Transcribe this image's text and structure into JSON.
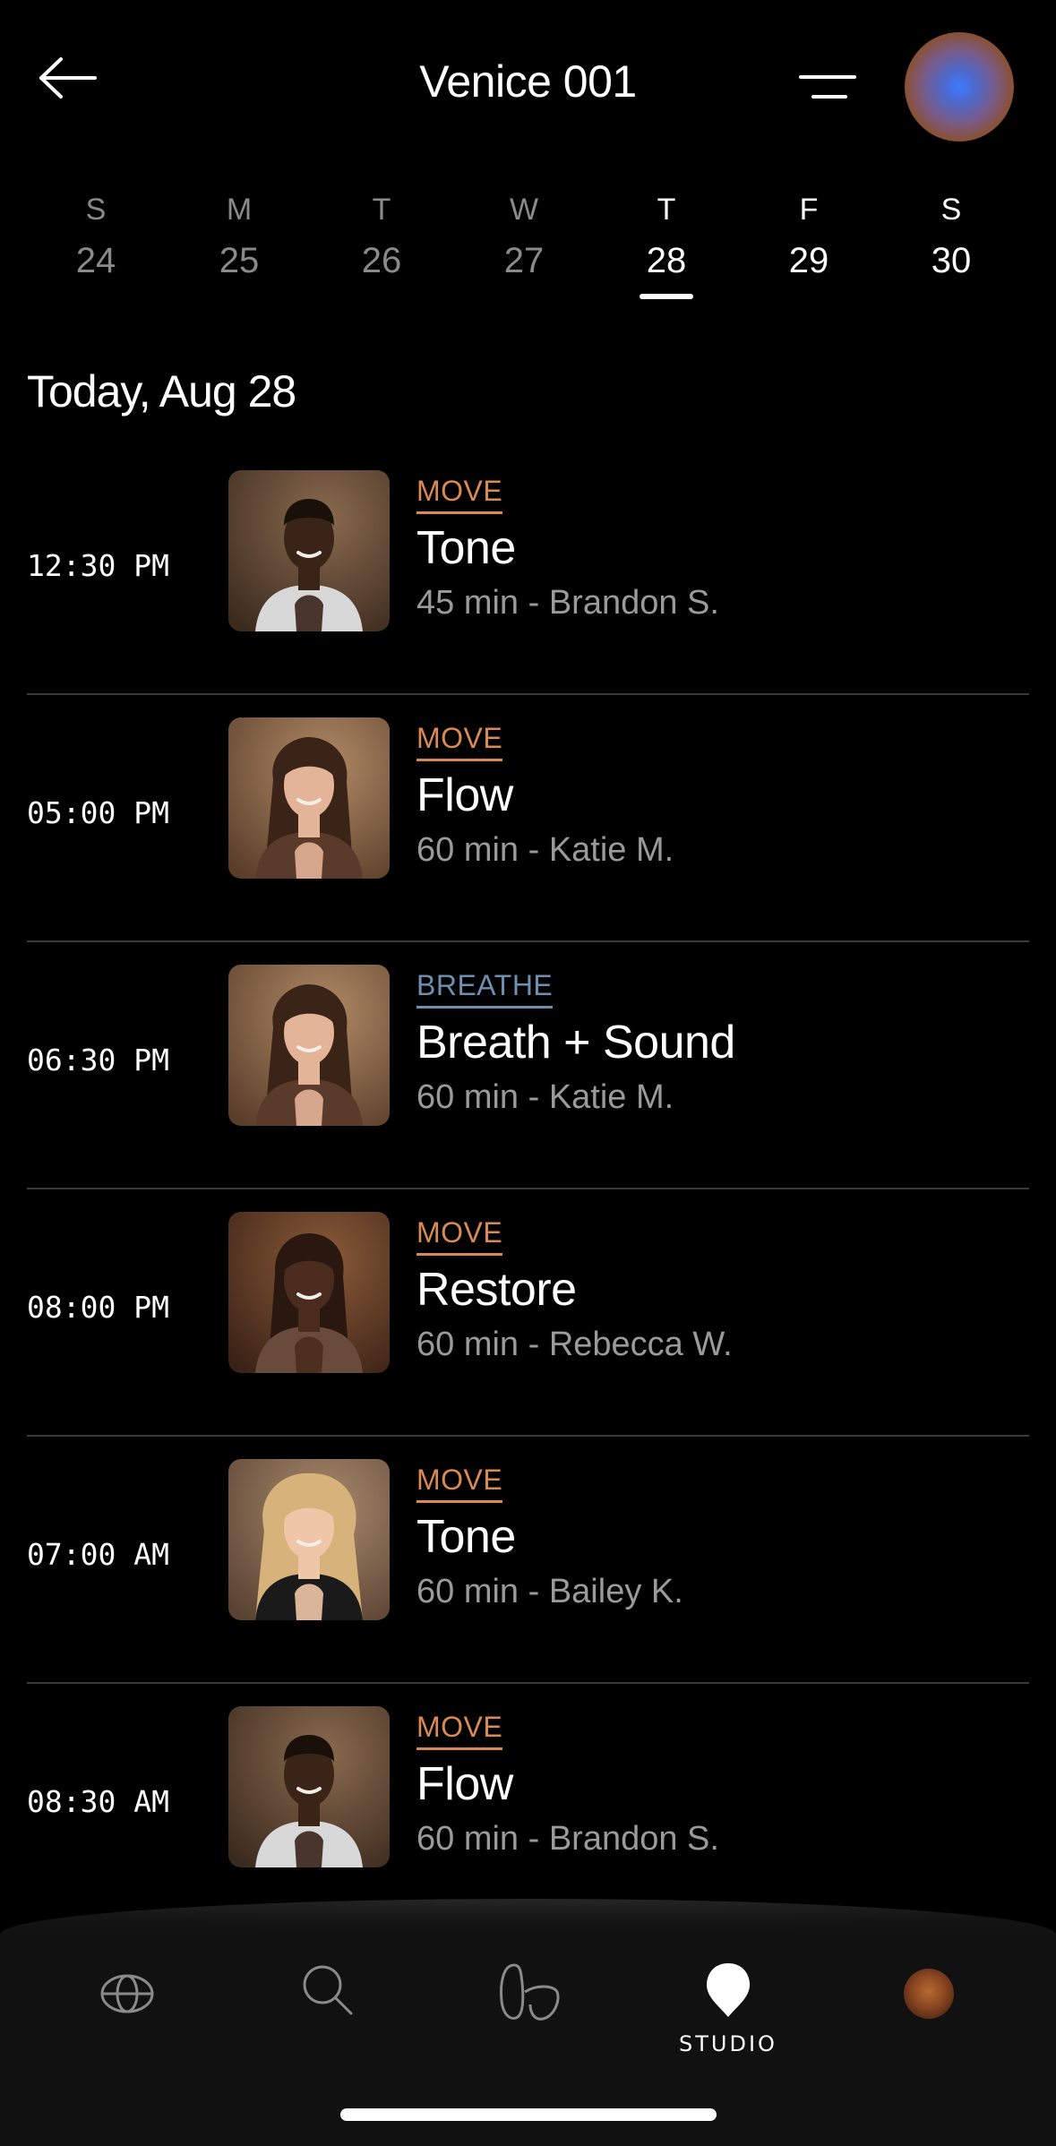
{
  "header": {
    "title": "Venice 001",
    "back_icon": "arrow-left-icon",
    "filter_icon": "filter-lines-icon"
  },
  "week": [
    {
      "dow": "S",
      "num": "24",
      "state": "past"
    },
    {
      "dow": "M",
      "num": "25",
      "state": "past"
    },
    {
      "dow": "T",
      "num": "26",
      "state": "past"
    },
    {
      "dow": "W",
      "num": "27",
      "state": "past"
    },
    {
      "dow": "T",
      "num": "28",
      "state": "selected"
    },
    {
      "dow": "F",
      "num": "29",
      "state": "future"
    },
    {
      "dow": "S",
      "num": "30",
      "state": "future"
    }
  ],
  "date_heading": "Today, Aug 28",
  "colors": {
    "move": "#d98a52",
    "breathe": "#6e8fb0",
    "background": "#000000",
    "divider": "#3a3a3a"
  },
  "classes": [
    {
      "time": "12:30 PM",
      "category": "MOVE",
      "name": "Tone",
      "meta": "45 min - Brandon S.",
      "avatar": "instructor-portrait-brandon"
    },
    {
      "time": "05:00 PM",
      "category": "MOVE",
      "name": "Flow",
      "meta": "60 min - Katie M.",
      "avatar": "instructor-portrait-katie"
    },
    {
      "time": "06:30 PM",
      "category": "BREATHE",
      "name": "Breath + Sound",
      "meta": "60 min - Katie M.",
      "avatar": "instructor-portrait-katie"
    },
    {
      "time": "08:00 PM",
      "category": "MOVE",
      "name": "Restore",
      "meta": "60 min - Rebecca W.",
      "avatar": "instructor-portrait-rebecca"
    },
    {
      "time": "07:00 AM",
      "category": "MOVE",
      "name": "Tone",
      "meta": "60 min - Bailey K.",
      "avatar": "instructor-portrait-bailey"
    },
    {
      "time": "08:30 AM",
      "category": "MOVE",
      "name": "Flow",
      "meta": "60 min - Brandon S.",
      "avatar": "instructor-portrait-brandon"
    }
  ],
  "nav": {
    "items": [
      {
        "icon": "globe-icon",
        "label": ""
      },
      {
        "icon": "search-icon",
        "label": ""
      },
      {
        "icon": "feet-icon",
        "label": ""
      },
      {
        "icon": "location-pin-icon",
        "label": "STUDIO",
        "active": true
      },
      {
        "icon": "profile-avatar-icon",
        "label": ""
      }
    ]
  }
}
